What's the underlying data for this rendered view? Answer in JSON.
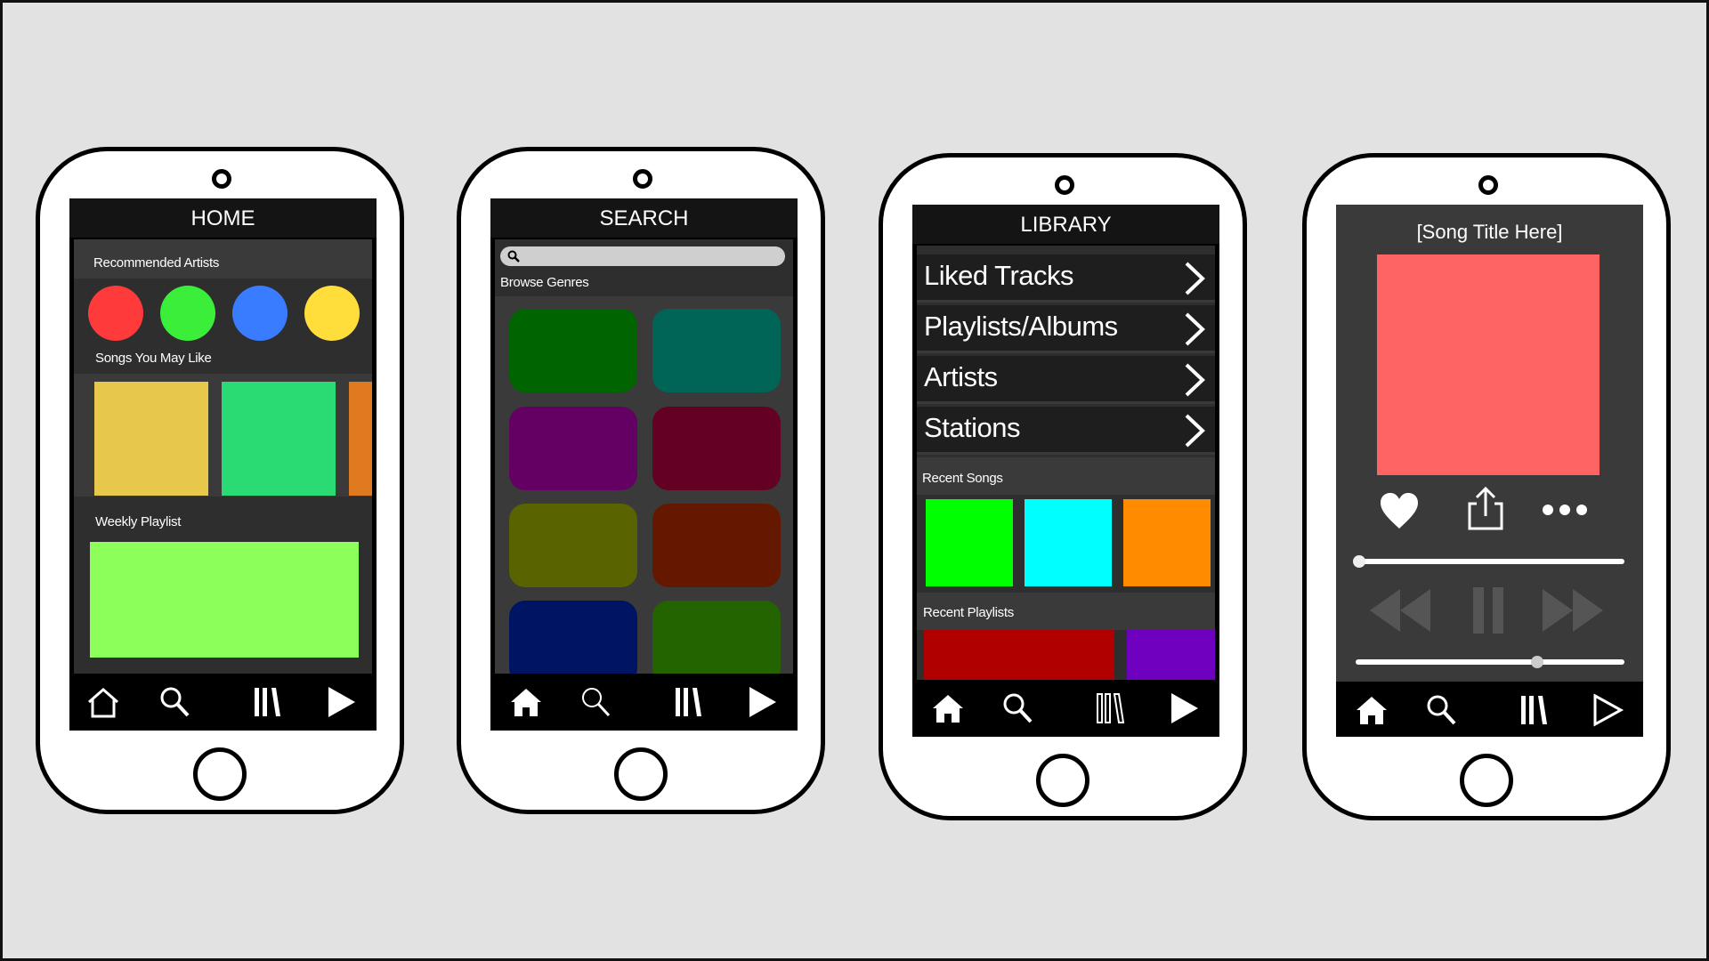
{
  "phones": {
    "home": {
      "title": "HOME",
      "recommended_label": "Recommended Artists",
      "songs_label": "Songs You May Like",
      "weekly_label": "Weekly Playlist",
      "artist_colors": [
        "#ff3a3a",
        "#3aee3a",
        "#3a7cff",
        "#ffdd3a"
      ],
      "song_colors": [
        "#e8c84a",
        "#2adb74",
        "#e07a20"
      ],
      "weekly_color": "#8cff5a"
    },
    "search": {
      "title": "SEARCH",
      "search_placeholder": "",
      "browse_label": "Browse Genres",
      "genre_colors": [
        "#006400",
        "#006457",
        "#640064",
        "#640024",
        "#596400",
        "#641800",
        "#001464",
        "#246400"
      ]
    },
    "library": {
      "title": "LIBRARY",
      "rows": [
        {
          "label": "Liked Tracks"
        },
        {
          "label": "Playlists/Albums"
        },
        {
          "label": "Artists"
        },
        {
          "label": "Stations"
        }
      ],
      "recent_songs_label": "Recent Songs",
      "recent_song_colors": [
        "#00ff00",
        "#00ffff",
        "#ff8c00"
      ],
      "recent_playlists_label": "Recent Playlists",
      "recent_playlist_colors": [
        "#b00000",
        "#7000c0"
      ]
    },
    "player": {
      "title": "[Song Title Here]",
      "art_color": "#ff6464",
      "progress": 0.0,
      "volume": 0.68
    }
  },
  "nav_icons": [
    "home-icon",
    "search-icon",
    "library-icon",
    "play-icon"
  ]
}
